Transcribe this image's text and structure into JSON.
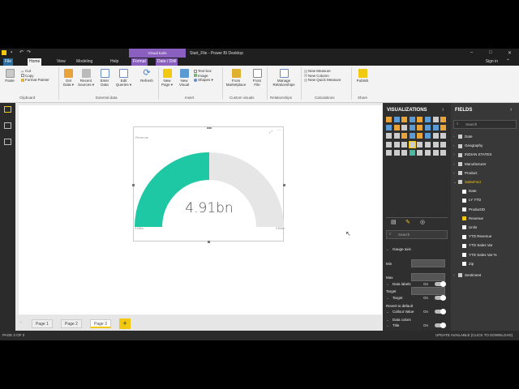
{
  "window": {
    "title": "Start_File - Power BI Desktop",
    "context_tab_group": "Visual tools",
    "controls": [
      "–",
      "□",
      "✕"
    ]
  },
  "menu": {
    "tabs": [
      "File",
      "Home",
      "View",
      "Modeling",
      "Help",
      "Format",
      "Data / Drill"
    ],
    "active": "Home",
    "sign_in": "Sign in"
  },
  "ribbon": {
    "paste": "Paste",
    "cut": "Cut",
    "copy": "Copy",
    "format_painter": "Format Painter",
    "get_data": "Get Data ▾",
    "recent_sources": "Recent Sources ▾",
    "enter_data": "Enter Data",
    "edit_queries": "Edit Queries ▾",
    "refresh": "Refresh",
    "new_page": "New Page ▾",
    "new_visual": "New Visual",
    "text_box": "Text box",
    "image": "Image",
    "shapes": "Shapes ▾",
    "from_marketplace": "From Marketplace",
    "from_file": "From File",
    "manage_relationships": "Manage Relationships",
    "new_measure": "New Measure",
    "new_column": "New Column",
    "new_quick_measure": "New Quick Measure",
    "publish": "Publish",
    "groups": {
      "clipboard": "Clipboard",
      "external_data": "External data",
      "insert": "Insert",
      "custom_visuals": "Custom visuals",
      "relationships": "Relationships",
      "calculations": "Calculations",
      "share": "Share"
    }
  },
  "gauge": {
    "title": "Revenue",
    "value_label": "4.91bn",
    "min_label": "0.00bn",
    "max_label": "9.83bn",
    "fill_fraction": 0.5,
    "colors": {
      "fill": "#1ec8a5",
      "track": "#e6e6e6"
    }
  },
  "pages": {
    "tabs": [
      "Page 1",
      "Page 2",
      "Page 3"
    ],
    "active": "Page 3",
    "add": "+"
  },
  "status": {
    "page_indicator": "PAGE 3 OF 3",
    "update": "UPDATE AVAILABLE (CLICK TO DOWNLOAD)"
  },
  "visualizations": {
    "header": "VISUALIZATIONS",
    "search_placeholder": "Search",
    "gauge_axis": "Gauge axis",
    "min": "Min",
    "max": "Max",
    "target_field": "Target",
    "revert": "Revert to default",
    "data_colors": "Data colors",
    "data_labels": "Data labels",
    "target": "Target",
    "callout_value": "Callout Value",
    "title": "Title",
    "on": "On"
  },
  "fields": {
    "header": "FIELDS",
    "search_placeholder": "Search",
    "tables": [
      "Date",
      "Geography",
      "INDIAN STATES",
      "Manufacturer",
      "Product",
      "SalesFact"
    ],
    "salesfact_fields": [
      "Date",
      "LY YTD",
      "ProductID",
      "Revenue",
      "Units",
      "YTD Revenue",
      "YTD Sales Var",
      "YTD Sales Var %",
      "Zip"
    ],
    "checked": "Revenue",
    "after": [
      "Sentiment"
    ]
  },
  "colors": {
    "accent": "#f2c811",
    "teal": "#1ec8a5",
    "purple": "#8b5fbf"
  }
}
